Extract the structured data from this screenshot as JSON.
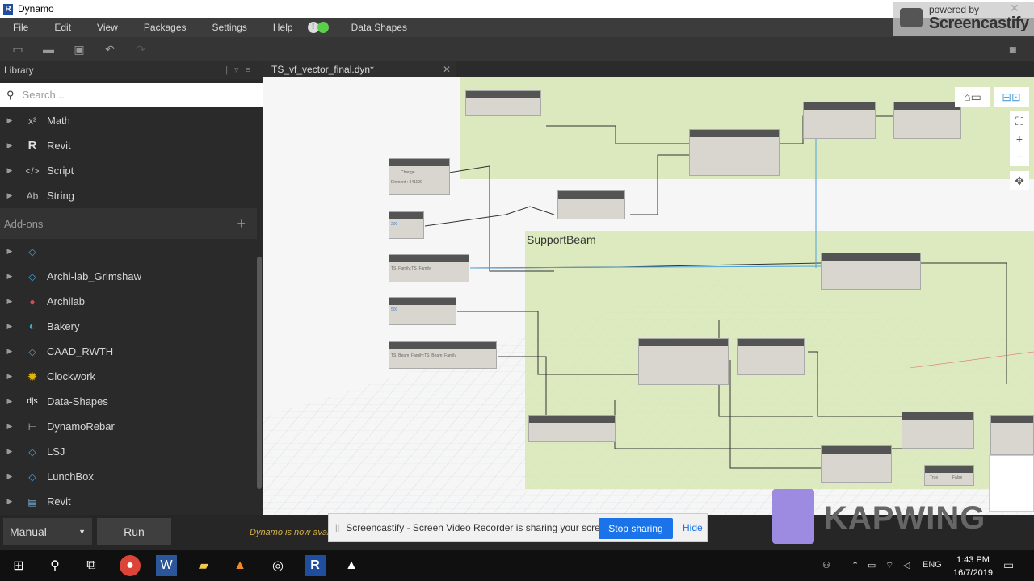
{
  "app": {
    "title": "Dynamo"
  },
  "menu": [
    "File",
    "Edit",
    "View",
    "Packages",
    "Settings",
    "Help",
    "Data Shapes"
  ],
  "library": {
    "heading": "Library",
    "search_placeholder": "Search...",
    "categories": [
      {
        "icon": "x²",
        "label": "Math"
      },
      {
        "icon": "R",
        "label": "Revit"
      },
      {
        "icon": "</>",
        "label": "Script"
      },
      {
        "icon": "Ab",
        "label": "String"
      }
    ],
    "addons_label": "Add-ons",
    "addons": [
      {
        "icon": "◇",
        "label": ""
      },
      {
        "icon": "◇",
        "label": "Archi-lab_Grimshaw"
      },
      {
        "icon": "●",
        "label": "Archilab"
      },
      {
        "icon": "◐",
        "label": "Bakery"
      },
      {
        "icon": "◇",
        "label": "CAAD_RWTH"
      },
      {
        "icon": "✹",
        "label": "Clockwork"
      },
      {
        "icon": "d|s",
        "label": "Data-Shapes"
      },
      {
        "icon": "⊢",
        "label": "DynamoRebar"
      },
      {
        "icon": "◇",
        "label": "LSJ"
      },
      {
        "icon": "◇",
        "label": "LunchBox"
      },
      {
        "icon": "▤",
        "label": "Revit"
      }
    ]
  },
  "tab": {
    "title": "TS_vf_vector_final.dyn*"
  },
  "canvas": {
    "group_label": "SupportBeam",
    "nodes": {
      "change_title": "Change",
      "change_value": "Element : 341120",
      "input_1": "200",
      "family_1": "TS_Family:TS_Family",
      "input_2": "500",
      "family_2": "TS_Beam_Family:TS_Beam_Family",
      "bool_true": "True",
      "bool_false": "False"
    }
  },
  "run": {
    "mode": "Manual",
    "button": "Run",
    "status": "Dynamo is now available"
  },
  "notification": {
    "text": "Screencastify - Screen Video Recorder is sharing your screen.",
    "stop_button": "Stop sharing",
    "hide_button": "Hide"
  },
  "watermark": {
    "powered": "powered by",
    "name": "Screencastify",
    "kapwing": "KAPWING"
  },
  "taskbar": {
    "lang": "ENG",
    "time": "1:43 PM",
    "date": "16/7/2019"
  }
}
